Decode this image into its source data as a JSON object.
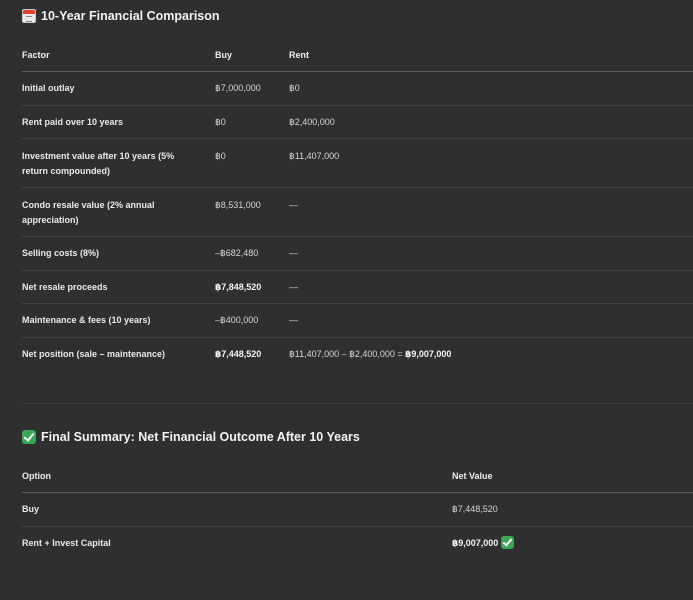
{
  "comparison": {
    "title": "10-Year Financial Comparison",
    "icon": "calendar-icon",
    "columns": [
      "Factor",
      "Buy",
      "Rent"
    ],
    "rows": [
      {
        "factor": "Initial outlay",
        "buy": "฿7,000,000",
        "rent": "฿0"
      },
      {
        "factor": "Rent paid over 10 years",
        "buy": "฿0",
        "rent": "฿2,400,000"
      },
      {
        "factor": "Investment value after 10 years (5% return compounded)",
        "buy": "฿0",
        "rent": "฿11,407,000"
      },
      {
        "factor": "Condo resale value (2% annual appreciation)",
        "buy": "฿8,531,000",
        "rent": "—"
      },
      {
        "factor": "Selling costs (8%)",
        "buy": "–฿682,480",
        "rent": "—"
      },
      {
        "factor": "Net resale proceeds",
        "buy": "฿7,848,520",
        "rent": "—"
      },
      {
        "factor": "Maintenance & fees (10 years)",
        "buy": "–฿400,000",
        "rent": "—"
      },
      {
        "factor": "Net position (sale – maintenance)",
        "buy": "฿7,448,520",
        "rent_prefix": "฿11,407,000 – ฿2,400,000 = ",
        "rent_total": "฿9,007,000"
      }
    ]
  },
  "summary": {
    "title": "Final Summary: Net Financial Outcome After 10 Years",
    "icon": "check-mark-icon",
    "columns": [
      "Option",
      "Net Value"
    ],
    "rows": [
      {
        "option": "Buy",
        "value": "฿7,448,520"
      },
      {
        "option": "Rent + Invest Capital",
        "value": "฿9,007,000",
        "badge": "check-mark-icon"
      }
    ]
  }
}
